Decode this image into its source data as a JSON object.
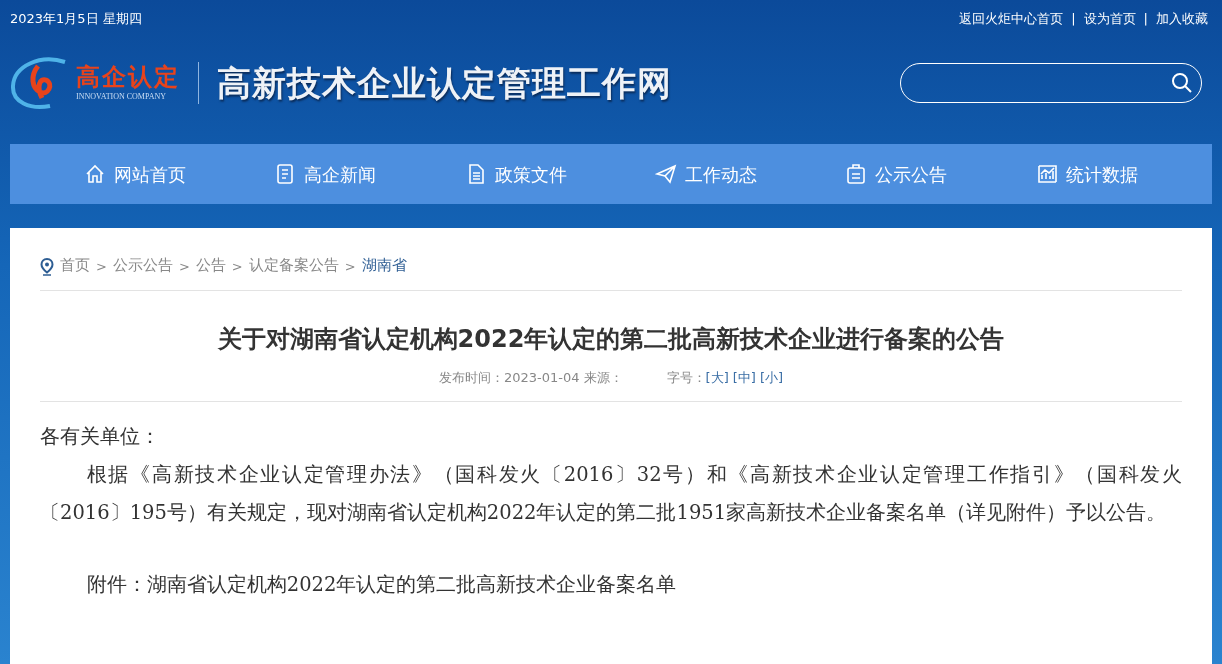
{
  "top_bar": {
    "date": "2023年1月5日 星期四",
    "links": [
      "返回火炬中心首页",
      "设为首页",
      "加入收藏"
    ],
    "separator": "|"
  },
  "logo": {
    "mark_text": "高企认定",
    "mark_subtext": "INNOVATION COMPANY",
    "site_title": "高新技术企业认定管理工作网"
  },
  "nav": [
    {
      "label": "网站首页"
    },
    {
      "label": "高企新闻"
    },
    {
      "label": "政策文件"
    },
    {
      "label": "工作动态"
    },
    {
      "label": "公示公告"
    },
    {
      "label": "统计数据"
    }
  ],
  "breadcrumb": [
    {
      "label": "首页",
      "selected": false
    },
    {
      "label": "公示公告",
      "selected": false
    },
    {
      "label": "公告",
      "selected": false
    },
    {
      "label": "认定备案公告",
      "selected": false
    },
    {
      "label": "湖南省",
      "selected": true
    }
  ],
  "breadcrumb_separator": ">",
  "article": {
    "title": "关于对湖南省认定机构2022年认定的第二批高新技术企业进行备案的公告",
    "meta": "发布时间：2023-01-04 来源：",
    "font_size_label": "字号：",
    "font_sizes": [
      "[大]",
      "[中]",
      "[小]"
    ],
    "salutation": "各有关单位：",
    "paragraphs": [
      "根据《高新技术企业认定管理办法》（国科发火〔2016〕32号）和《高新技术企业认定管理工作指引》（国科发火〔2016〕195号）有关规定，现对湖南省认定机构2022年认定的第二批1951家高新技术企业备案名单（详见附件）予以公告。"
    ],
    "attachment": "附件：湖南省认定机构2022年认定的第二批高新技术企业备案名单"
  }
}
